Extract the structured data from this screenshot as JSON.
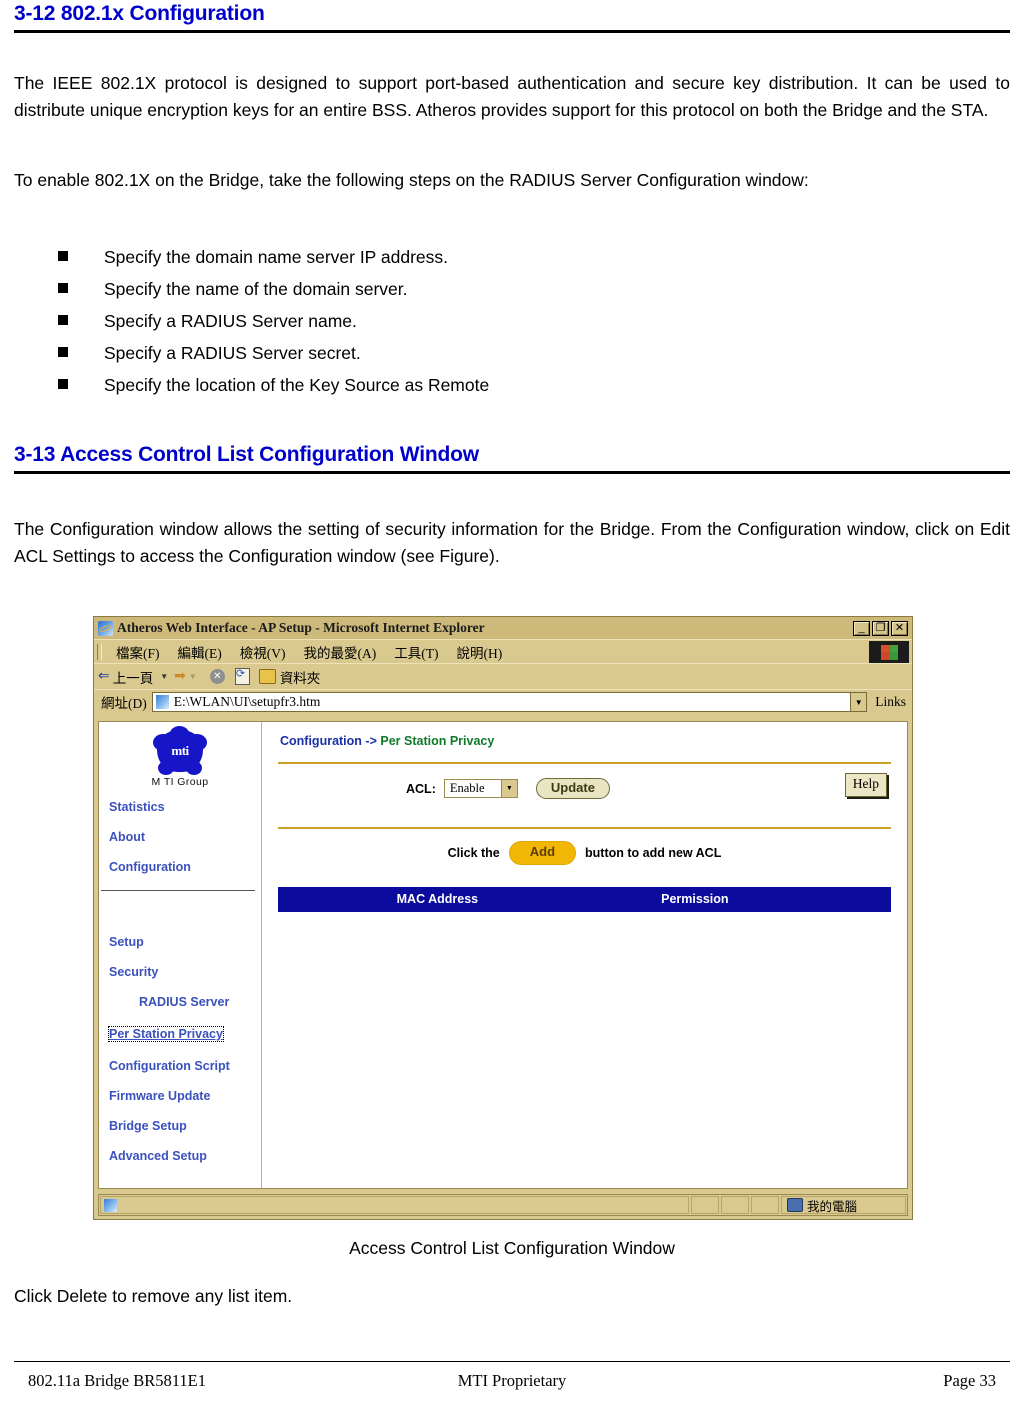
{
  "document": {
    "sections": [
      {
        "number_title": "3-12 802.1x Configuration"
      },
      {
        "number_title": "3-13 Access Control List Configuration Window"
      }
    ],
    "paragraphs": {
      "p1": "The IEEE 802.1X protocol is designed to support port-based authentication and secure key distribution. It can be used to distribute unique encryption keys for an entire BSS. Atheros provides support for this protocol on both the Bridge and the STA.",
      "p2": "To enable 802.1X on the Bridge, take the following steps on the RADIUS Server Configuration window:",
      "p3": "The Configuration window allows the setting of security information for the Bridge. From the Configuration window, click on Edit ACL Settings to access the Configuration window (see Figure).",
      "p4": "Click Delete to remove any list item."
    },
    "bullets": [
      "Specify the domain name server IP address.",
      "Specify the name of the domain server.",
      "Specify a RADIUS Server name.",
      "Specify a RADIUS Server secret.",
      "Specify the location of the Key Source as Remote"
    ],
    "figure_caption": "Access Control List Configuration Window",
    "footer": {
      "left": "802.11a Bridge BR5811E1",
      "center": "MTI Proprietary",
      "right": "Page 33"
    }
  },
  "browser": {
    "title": "Atheros Web Interface - AP Setup - Microsoft Internet Explorer",
    "window_buttons": {
      "minimize": "_",
      "restore": "❐",
      "close": "✕"
    },
    "menu_items": [
      "檔案(F)",
      "編輯(E)",
      "檢視(V)",
      "我的最愛(A)",
      "工具(T)",
      "說明(H)"
    ],
    "toolbar": {
      "back": "上一頁",
      "folders": "資料夾"
    },
    "address": {
      "label": "網址(D)",
      "value": "E:\\WLAN\\UI\\setupfr3.htm",
      "links_label": "Links"
    },
    "status": {
      "zone": "我的電腦"
    }
  },
  "webui": {
    "logo": {
      "wordmark": "mti",
      "caption": "M TI Group"
    },
    "nav": {
      "top": [
        {
          "label": "Statistics"
        },
        {
          "label": "About"
        },
        {
          "label": "Configuration"
        }
      ],
      "bottom": [
        {
          "label": "Setup",
          "indent": false,
          "focused": false
        },
        {
          "label": "Security",
          "indent": false,
          "focused": false
        },
        {
          "label": "RADIUS Server",
          "indent": true,
          "focused": false
        },
        {
          "label": "Per Station Privacy",
          "indent": false,
          "focused": true
        },
        {
          "label": "Configuration Script",
          "indent": false,
          "focused": false
        },
        {
          "label": "Firmware Update",
          "indent": false,
          "focused": false
        },
        {
          "label": "Bridge Setup",
          "indent": false,
          "focused": false
        },
        {
          "label": "Advanced Setup",
          "indent": false,
          "focused": false
        }
      ]
    },
    "breadcrumb": {
      "part1": "Configuration",
      "separator": " -> ",
      "part2": "Per Station Privacy"
    },
    "acl": {
      "label": "ACL:",
      "selected_value": "Enable",
      "update_button": "Update",
      "help_button": "Help"
    },
    "add_hint": {
      "prefix": "Click the",
      "button": "Add",
      "suffix": "button to add new ACL"
    },
    "table": {
      "columns": [
        "MAC Address",
        "Permission"
      ],
      "rows": []
    },
    "colors": {
      "nav_link": "#3B51BE",
      "breadcrumb_green": "#0E7A28",
      "table_header_bg": "#0B0B9E",
      "add_button_bg": "#F2B705",
      "gold_rule": "#C9A227",
      "heading_blue": "#0000CC"
    }
  }
}
